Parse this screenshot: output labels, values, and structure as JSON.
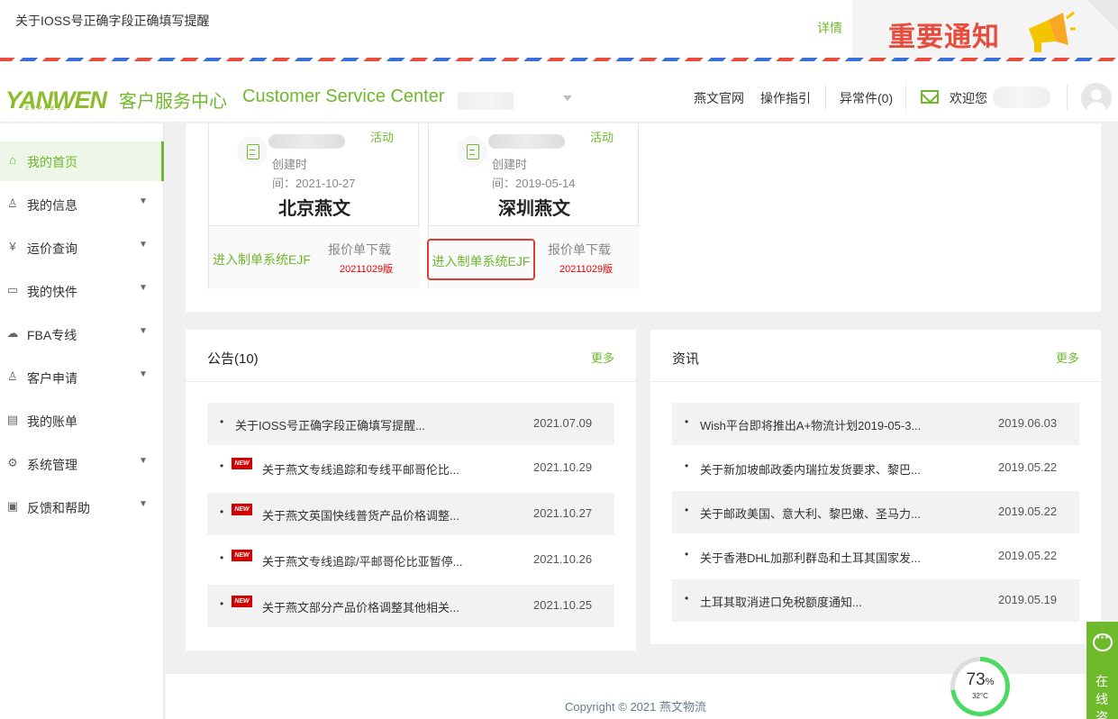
{
  "notice": {
    "text": "关于IOSS号正确字段正确填写提醒",
    "detail": "详情",
    "banner_title": "重要通知"
  },
  "header": {
    "logo": "YANWEN",
    "logo_sub": "EXPRESS",
    "title_cn": "客户服务中心",
    "title_en": "Customer Service Center",
    "nav": [
      "燕文官网",
      "操作指引",
      "异常件(0)"
    ],
    "welcome": "欢迎您"
  },
  "sidebar": {
    "items": [
      {
        "label": "我的首页",
        "icon": "⌂",
        "chevron": false,
        "active": true
      },
      {
        "label": "我的信息",
        "icon": "♙",
        "chevron": true
      },
      {
        "label": "运价查询",
        "icon": "¥",
        "chevron": true
      },
      {
        "label": "我的快件",
        "icon": "▭",
        "chevron": true
      },
      {
        "label": "FBA专线",
        "icon": "☁",
        "chevron": true
      },
      {
        "label": "客户申请",
        "icon": "♙",
        "chevron": true
      },
      {
        "label": "我的账单",
        "icon": "▤",
        "chevron": false
      },
      {
        "label": "系统管理",
        "icon": "⚙",
        "chevron": true
      },
      {
        "label": "反馈和帮助",
        "icon": "▣",
        "chevron": true
      }
    ]
  },
  "branches": [
    {
      "badge": "活动",
      "created_1": "创建时",
      "created_2": "间：2021-10-27",
      "city": "北京燕文",
      "enter": "进入制单系统EJF",
      "price": "报价单下载",
      "version": "20211029版"
    },
    {
      "badge": "活动",
      "created_1": "创建时",
      "created_2": "间：2019-05-14",
      "city": "深圳燕文",
      "enter": "进入制单系统EJF",
      "price": "报价单下载",
      "version": "20211029版"
    }
  ],
  "announcements": {
    "title": "公告(10)",
    "more": "更多",
    "rows": [
      {
        "text": "关于IOSS号正确字段正确填写提醒...",
        "date": "2021.07.09",
        "new": false
      },
      {
        "text": "关于燕文专线追踪和专线平邮哥伦比...",
        "date": "2021.10.29",
        "new": true
      },
      {
        "text": "关于燕文英国快线普货产品价格调整...",
        "date": "2021.10.27",
        "new": true
      },
      {
        "text": "关于燕文专线追踪/平邮哥伦比亚暂停...",
        "date": "2021.10.26",
        "new": true
      },
      {
        "text": "关于燕文部分产品价格调整其他相关...",
        "date": "2021.10.25",
        "new": true
      }
    ]
  },
  "news": {
    "title": "资讯",
    "more": "更多",
    "rows": [
      {
        "text": "Wish平台即将推出A+物流计划2019-05-3...",
        "date": "2019.06.03"
      },
      {
        "text": "关于新加坡邮政委内瑞拉发货要求、黎巴...",
        "date": "2019.05.22"
      },
      {
        "text": "关于邮政美国、意大利、黎巴嫩、圣马力...",
        "date": "2019.05.22"
      },
      {
        "text": "关于香港DHL加那利群岛和土耳其国家发...",
        "date": "2019.05.22"
      },
      {
        "text": "土耳其取消进口免税额度通知...",
        "date": "2019.05.19"
      }
    ]
  },
  "footer": {
    "copyright": "Copyright © 2021 燕文物流"
  },
  "gauge": {
    "percent": "73",
    "unit": "%",
    "temp": "32°C",
    "fraction": 0.73
  },
  "chat": {
    "label": "在线咨"
  },
  "new_badge": "NEW",
  "colors": {
    "brand": "#6fb92c",
    "alert": "#e74c3c"
  }
}
